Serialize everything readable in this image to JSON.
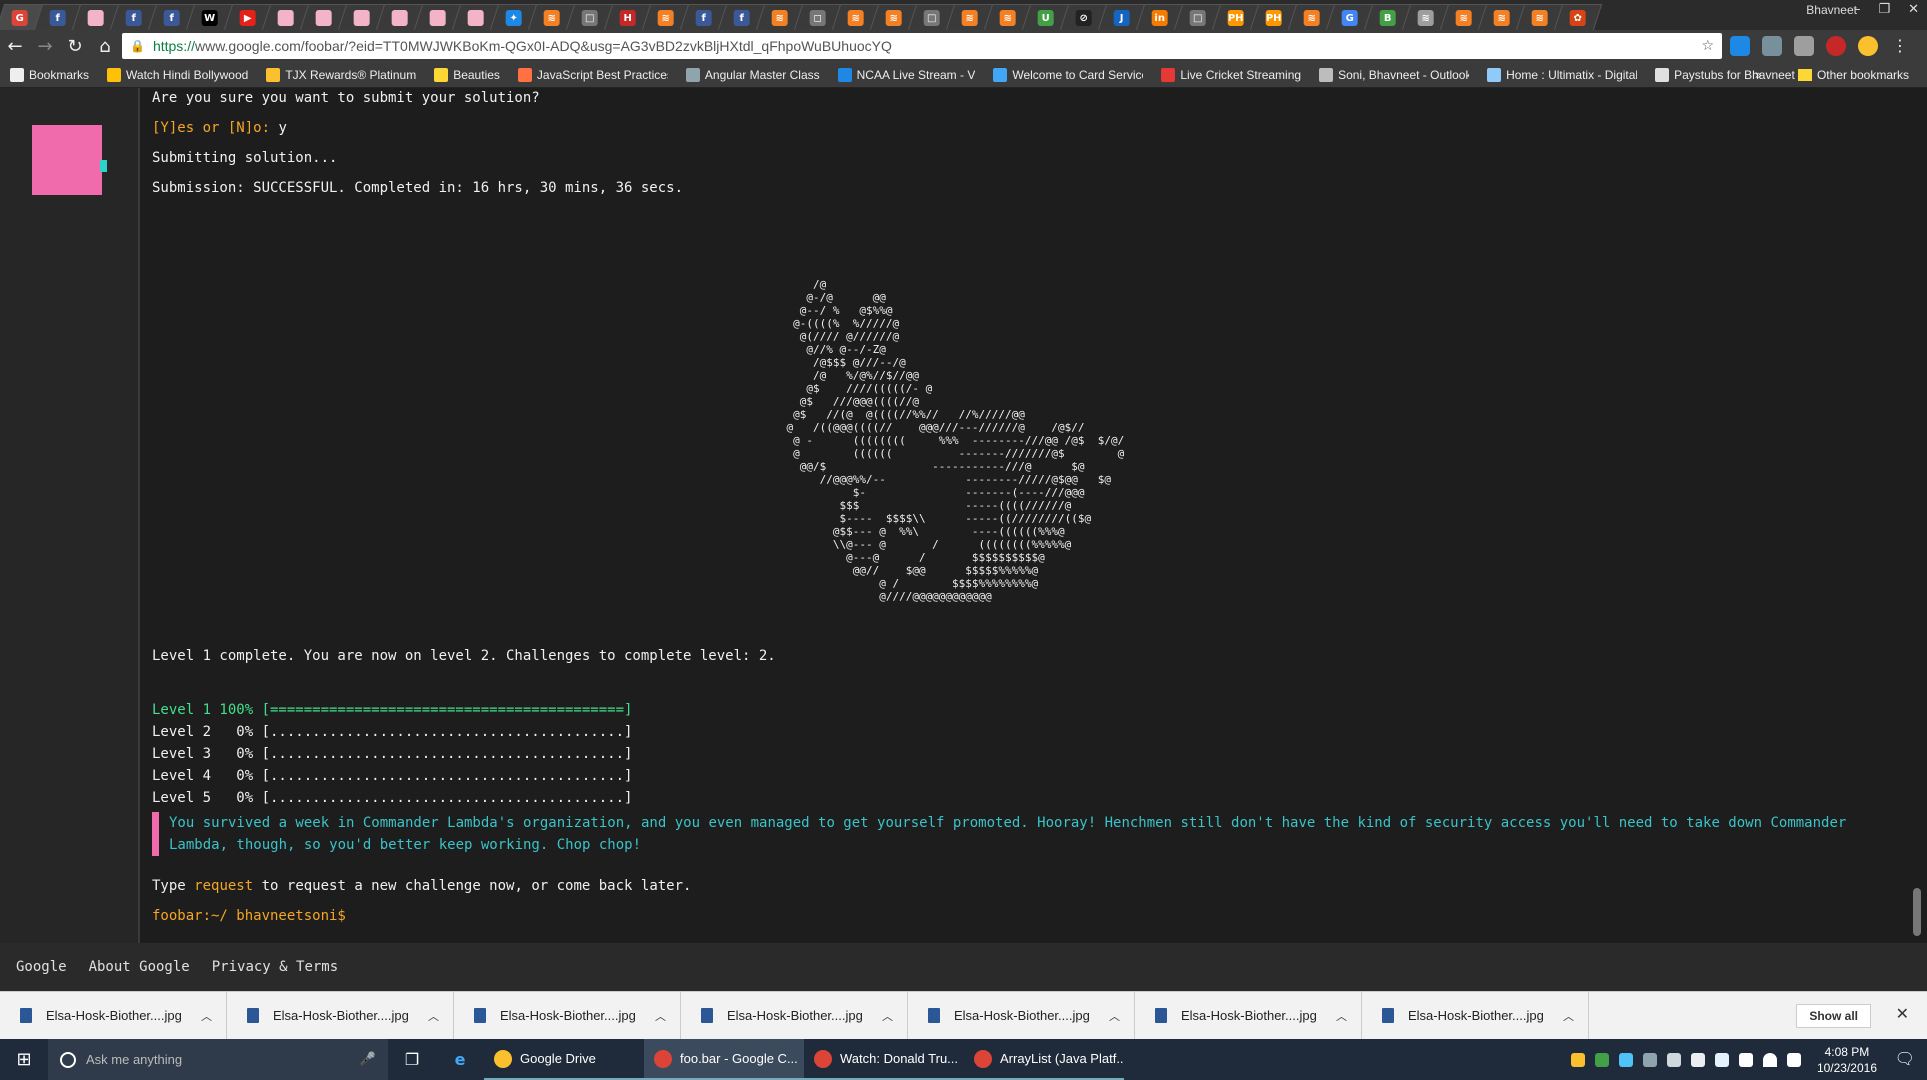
{
  "browser": {
    "profile_name": "Bhavneet",
    "url_scheme": "https://",
    "url_rest": "www.google.com/foobar/?eid=TT0MWJWKBoKm-QGx0I-ADQ&usg=AG3vBD2zvkBljHXtdl_qFhpoWuBUhuocYQ",
    "tab_favicons": [
      {
        "glyph": "G",
        "color": "#db4437"
      },
      {
        "glyph": "f",
        "color": "#3b5998"
      },
      {
        "glyph": "",
        "color": "#f4b4c8"
      },
      {
        "glyph": "f",
        "color": "#3b5998"
      },
      {
        "glyph": "f",
        "color": "#3b5998"
      },
      {
        "glyph": "W",
        "color": "#000000"
      },
      {
        "glyph": "▶",
        "color": "#e62117"
      },
      {
        "glyph": "",
        "color": "#f4b4c8"
      },
      {
        "glyph": "",
        "color": "#f4b4c8"
      },
      {
        "glyph": "",
        "color": "#f4b4c8"
      },
      {
        "glyph": "",
        "color": "#f4b4c8"
      },
      {
        "glyph": "",
        "color": "#f4b4c8"
      },
      {
        "glyph": "",
        "color": "#f4b4c8"
      },
      {
        "glyph": "✦",
        "color": "#1e88e5"
      },
      {
        "glyph": "≋",
        "color": "#f48024"
      },
      {
        "glyph": "□",
        "color": "#777777"
      },
      {
        "glyph": "H",
        "color": "#c62828"
      },
      {
        "glyph": "≋",
        "color": "#f48024"
      },
      {
        "glyph": "f",
        "color": "#3b5998"
      },
      {
        "glyph": "f",
        "color": "#3b5998"
      },
      {
        "glyph": "≋",
        "color": "#f48024"
      },
      {
        "glyph": "◻",
        "color": "#777777"
      },
      {
        "glyph": "≋",
        "color": "#f48024"
      },
      {
        "glyph": "≋",
        "color": "#f48024"
      },
      {
        "glyph": "□",
        "color": "#777777"
      },
      {
        "glyph": "≋",
        "color": "#f48024"
      },
      {
        "glyph": "≋",
        "color": "#f48024"
      },
      {
        "glyph": "U",
        "color": "#43a047"
      },
      {
        "glyph": "⊘",
        "color": "#222222"
      },
      {
        "glyph": "J",
        "color": "#1565c0"
      },
      {
        "glyph": "in",
        "color": "#f57c00"
      },
      {
        "glyph": "□",
        "color": "#777777"
      },
      {
        "glyph": "PH",
        "color": "#ff9800"
      },
      {
        "glyph": "PH",
        "color": "#ff9800"
      },
      {
        "glyph": "≋",
        "color": "#f48024"
      },
      {
        "glyph": "G",
        "color": "#4285f4"
      },
      {
        "glyph": "B",
        "color": "#43a047"
      },
      {
        "glyph": "≋",
        "color": "#9e9e9e"
      },
      {
        "glyph": "≋",
        "color": "#f48024"
      },
      {
        "glyph": "≋",
        "color": "#f48024"
      },
      {
        "glyph": "≋",
        "color": "#f48024"
      },
      {
        "glyph": "✿",
        "color": "#d84315"
      }
    ],
    "bookmarks": [
      {
        "label": "Bookmarks",
        "color": "#eeeeee"
      },
      {
        "label": "Watch Hindi Bollywood",
        "color": "#ffc107"
      },
      {
        "label": "TJX Rewards® Platinum",
        "color": "#fbc02d"
      },
      {
        "label": "Beauties",
        "color": "#fdd835"
      },
      {
        "label": "JavaScript Best Practices",
        "color": "#ff7043"
      },
      {
        "label": "Angular Master Class",
        "color": "#90a4ae"
      },
      {
        "label": "NCAA Live Stream - V",
        "color": "#1e88e5"
      },
      {
        "label": "Welcome to Card Services",
        "color": "#42a5f5"
      },
      {
        "label": "Live Cricket Streaming",
        "color": "#e53935"
      },
      {
        "label": "Soni, Bhavneet - Outlook",
        "color": "#bdbdbd"
      },
      {
        "label": "Home : Ultimatix - Digital",
        "color": "#90caf9"
      },
      {
        "label": "Paystubs for Bhavneet",
        "color": "#e0e0e0"
      }
    ],
    "other_bookmarks": "Other bookmarks"
  },
  "terminal": {
    "confirm_question": "Are you sure you want to submit your solution?",
    "prompt_yn": "[Y]es or [N]o: ",
    "answer": "y",
    "submitting": "Submitting solution...",
    "submission_result": "Submission: SUCCESSFUL. Completed in: 16 hrs, 30 mins, 36 secs.",
    "ascii_art": "        /@\n       @-/@      @@\n      @--/ %   @$%%@\n     @-((((%  %/////@\n      @(//// @//////@\n       @//% @--/-Z@\n        /@$$$ @///--/@\n        /@   %/@%//$//@@\n       @$    ////(((((/- @\n      @$   ///@@@((((//@\n     @$   //(@  @((((//%%//   //%/////@@\n    @   /((@@@((((//    @@@///---//////@    /@$//\n     @ -      ((((((((     %%%  --------///@@ /@$  $/@/\n     @        ((((((          -------///////@$        @\n      @@/$                -----------///@      $@\n         //@@@%%/--            --------/////@$@@   $@\n              $-               -------(----///@@@\n            $$$                -----((((//////@\n            $----  $$$$\\\\      -----((////////(($@\n           @$$--- @  %%\\        ----((((((%%%@\n           \\\\@--- @       /      ((((((((%%%%%@\n             @---@      /       $$$$$$$$$$@\n              @@//    $@@      $$$$$%%%%%@\n                  @ /        $$$$%%%%%%%%@\n                  @////@@@@@@@@@@@@",
    "level_complete": "Level 1 complete. You are now on level 2. Challenges to complete level: 2.",
    "levels": [
      {
        "text": "Level 1 100% [==========================================]",
        "done": true
      },
      {
        "text": "Level 2   0% [..........................................]",
        "done": false
      },
      {
        "text": "Level 3   0% [..........................................]",
        "done": false
      },
      {
        "text": "Level 4   0% [..........................................]",
        "done": false
      },
      {
        "text": "Level 5   0% [..........................................]",
        "done": false
      }
    ],
    "message": "You survived a week in Commander Lambda's organization, and you even managed to get yourself promoted. Hooray! Henchmen still don't have the kind of security access you'll need to take down Commander Lambda, though, so you'd better keep working. Chop chop!",
    "type_prefix": "Type ",
    "type_cmd": "request",
    "type_suffix": " to request a new challenge now, or come back later.",
    "shell_prompt": "foobar:~/ bhavneetsoni$"
  },
  "footer": {
    "links": [
      "Google",
      "About Google",
      "Privacy & Terms"
    ]
  },
  "downloads": {
    "items": [
      "Elsa-Hosk-Biother....jpg",
      "Elsa-Hosk-Biother....jpg",
      "Elsa-Hosk-Biother....jpg",
      "Elsa-Hosk-Biother....jpg",
      "Elsa-Hosk-Biother....jpg",
      "Elsa-Hosk-Biother....jpg",
      "Elsa-Hosk-Biother....jpg"
    ],
    "show_all": "Show all"
  },
  "taskbar": {
    "search_placeholder": "Ask me anything",
    "apps": [
      {
        "label": "Google Drive",
        "color": "#fbc02d",
        "active": false
      },
      {
        "label": "foo.bar - Google C...",
        "color": "#db4437",
        "active": true
      },
      {
        "label": "Watch: Donald Tru...",
        "color": "#db4437",
        "active": false
      },
      {
        "label": "ArrayList (Java Platf...",
        "color": "#db4437",
        "active": false
      }
    ],
    "time": "4:08 PM",
    "date": "10/23/2016"
  }
}
